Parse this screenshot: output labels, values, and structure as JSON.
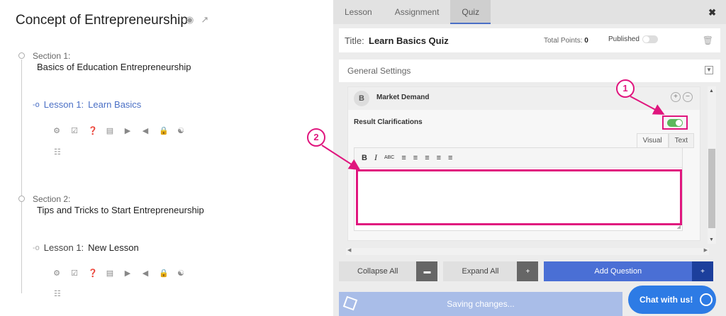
{
  "course": {
    "title": "Concept of Entrepreneurship",
    "sections": [
      {
        "label": "Section 1:",
        "name": "Basics of Education Entrepreneurship",
        "lesson": {
          "label": "Lesson 1:",
          "name": "Learn Basics"
        }
      },
      {
        "label": "Section 2:",
        "name": "Tips and Tricks to Start Entrepreneurship",
        "lesson": {
          "label": "Lesson 1:",
          "name": "New Lesson"
        }
      }
    ]
  },
  "tabs": [
    "Lesson",
    "Assignment",
    "Quiz"
  ],
  "quiz": {
    "title_label": "Title:",
    "title_value": "Learn Basics Quiz",
    "total_points_label": "Total Points:",
    "total_points_value": "0",
    "published_label": "Published",
    "general_settings": "General Settings",
    "answer_letter": "B",
    "answer_text": "Market Demand",
    "result_clarifications": "Result Clarifications",
    "editor_tab_visual": "Visual",
    "editor_tab_text": "Text"
  },
  "buttons": {
    "collapse_all": "Collapse All",
    "expand_all": "Expand All",
    "add_question": "Add Question"
  },
  "saving": "Saving changes...",
  "chat": "Chat with us!",
  "annotations": [
    "1",
    "2"
  ],
  "colors": {
    "accent": "#4a6fd5",
    "highlight": "#e0167e",
    "toggle_on": "#5cb85c",
    "chat": "#2d7be5"
  }
}
